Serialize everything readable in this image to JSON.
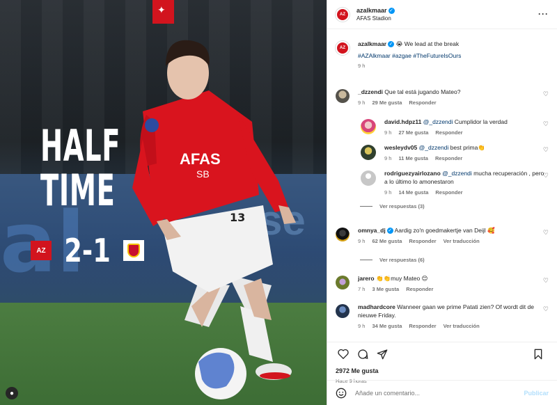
{
  "media": {
    "headline": [
      "HALF",
      "TIME"
    ],
    "score": "2-1",
    "home_crest": "AZ",
    "shirt_sponsor": "AFAS",
    "shirt_sponsor2": "SB",
    "board_text": "al",
    "board_text2": "se"
  },
  "post": {
    "username": "azalkmaar",
    "location": "AFAS Stadion",
    "caption_user": "azalkmaar",
    "caption_text": "😭 We lead at the break",
    "hashtags": "#AZAlkmaar #azgae #TheFutureIsOurs",
    "caption_time": "9 h",
    "likes": "2972 Me gusta",
    "posted_ago": "Hace 9 horas"
  },
  "comments": [
    {
      "user": "_dzzendi",
      "text": "Que tal está jugando Mateo?",
      "time": "9 h",
      "likes": "29 Me gusta",
      "reply": "Responder"
    },
    {
      "user": "david.hdpz11",
      "mention": "@_dzzendi",
      "text": " Cumplidor la verdad",
      "time": "9 h",
      "likes": "27 Me gusta",
      "reply": "Responder"
    },
    {
      "user": "wesleydv05",
      "mention": "@_dzzendi",
      "text": " best prima👏",
      "time": "9 h",
      "likes": "11 Me gusta",
      "reply": "Responder"
    },
    {
      "user": "rodriguezyairlozano",
      "mention": "@_dzzendi",
      "text": " mucha recuperación , pero a lo último lo amonestaron",
      "time": "9 h",
      "likes": "14 Me gusta",
      "reply": "Responder"
    },
    {
      "user": "omnya_dj",
      "text": "Aardig zo'n goedmakertje van Deijl 🥰",
      "time": "9 h",
      "likes": "62 Me gusta",
      "reply": "Responder",
      "translate": "Ver traducción"
    },
    {
      "user": "jarero",
      "text": "👏👏muy Mateo 😊",
      "time": "7 h",
      "likes": "3 Me gusta",
      "reply": "Responder"
    },
    {
      "user": "madhardcore",
      "text": "Wanneer gaan we prime Patati zien? Of wordt dit de nieuwe Friday.",
      "time": "9 h",
      "likes": "34 Me gusta",
      "reply": "Responder",
      "translate": "Ver traducción"
    }
  ],
  "view_replies_1": "Ver respuestas (3)",
  "view_replies_2": "Ver respuestas (6)",
  "add_comment": {
    "placeholder": "Añade un comentario...",
    "publish": "Publicar"
  },
  "colors": {
    "brand": "#d2141e",
    "link": "#00376b",
    "verified": "#0095f6"
  }
}
